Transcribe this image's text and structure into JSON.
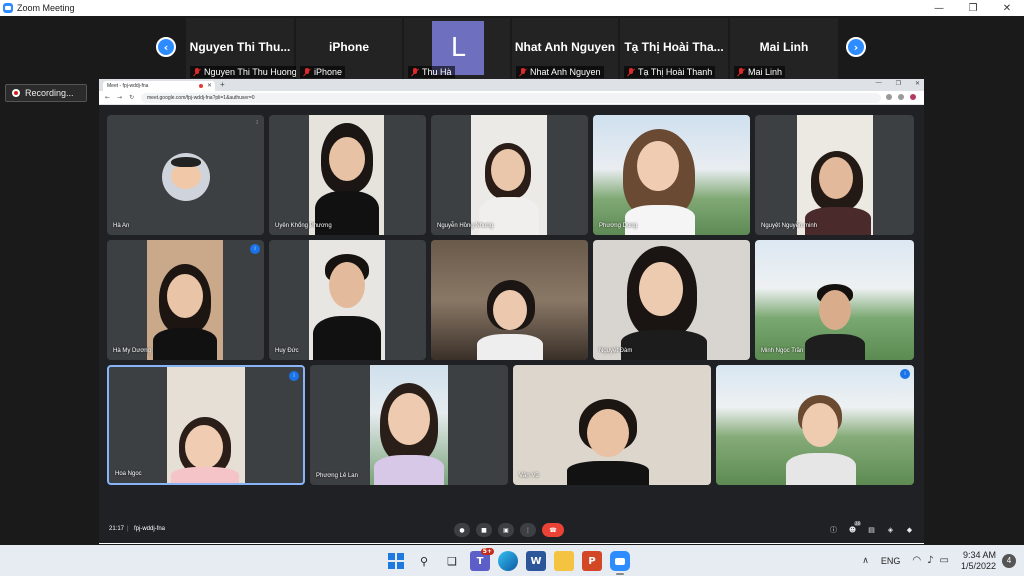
{
  "window": {
    "title": "Zoom Meeting"
  },
  "zoom": {
    "participants": [
      {
        "display": "Nguyen Thi Thu...",
        "label": "Nguyen Thi Thu Huong"
      },
      {
        "display": "iPhone",
        "label": "iPhone"
      },
      {
        "display": "L",
        "label": "Thu Hà",
        "avatar": true
      },
      {
        "display": "Nhat Anh Nguyen",
        "label": "Nhat Anh Nguyen"
      },
      {
        "display": "Tạ Thị Hoài Tha...",
        "label": "Tạ Thị Hoài Thanh"
      },
      {
        "display": "Mai Linh",
        "label": "Mai Linh"
      }
    ],
    "recording_label": "Recording..."
  },
  "browser": {
    "tab_title": "Meet - fpj-wddj-fna",
    "url": "meet.google.com/fpj-wddj-fna?pli=1&authuser=0"
  },
  "meet": {
    "tiles": [
      {
        "name": "Hà An"
      },
      {
        "name": "Uyên Khổng Phương"
      },
      {
        "name": "Nguyễn Hồng Nhung"
      },
      {
        "name": "Phương Dung"
      },
      {
        "name": "Nguyệt Nguyễn minh"
      },
      {
        "name": "Hà My Dương"
      },
      {
        "name": "Huy Đức"
      },
      {
        "name": ""
      },
      {
        "name": "Nguyệt Đàm"
      },
      {
        "name": "Minh Ngọc Trần"
      },
      {
        "name": "Hoa Ngoc"
      },
      {
        "name": "Phương Lê Lan"
      },
      {
        "name": "Vân Vũ"
      },
      {
        "name": ""
      }
    ],
    "time": "21:17",
    "code": "fpj-wddj-fna",
    "people_badge": "16"
  },
  "taskbar": {
    "teams_badge": "5+",
    "lang": "ENG",
    "time": "9:34 AM",
    "date": "1/5/2022",
    "notif_count": "4"
  }
}
